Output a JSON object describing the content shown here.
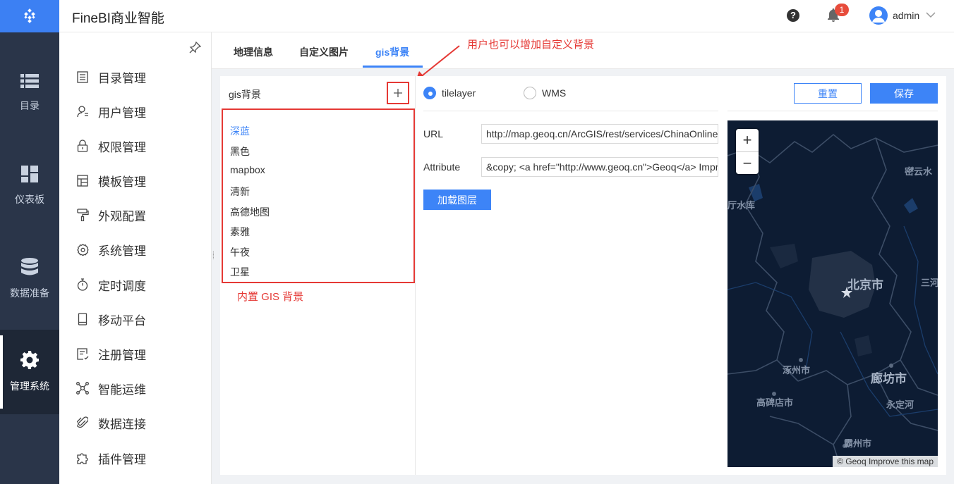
{
  "app": {
    "title": "FineBI商业智能"
  },
  "rail": {
    "items": [
      {
        "label": "目录",
        "icon": "list-icon"
      },
      {
        "label": "仪表板",
        "icon": "dashboard-icon"
      },
      {
        "label": "数据准备",
        "icon": "database-icon"
      },
      {
        "label": "管理系统",
        "icon": "gear-icon",
        "active": true
      }
    ]
  },
  "header": {
    "notification_count": "1",
    "user_name": "admin"
  },
  "nav": {
    "items": [
      {
        "label": "目录管理",
        "icon": "catalog-icon"
      },
      {
        "label": "用户管理",
        "icon": "user-icon"
      },
      {
        "label": "权限管理",
        "icon": "lock-icon"
      },
      {
        "label": "模板管理",
        "icon": "template-icon"
      },
      {
        "label": "外观配置",
        "icon": "paint-roller-icon"
      },
      {
        "label": "系统管理",
        "icon": "settings-icon"
      },
      {
        "label": "定时调度",
        "icon": "timer-icon"
      },
      {
        "label": "移动平台",
        "icon": "mobile-icon"
      },
      {
        "label": "注册管理",
        "icon": "register-icon"
      },
      {
        "label": "智能运维",
        "icon": "network-icon"
      },
      {
        "label": "数据连接",
        "icon": "paperclip-icon"
      },
      {
        "label": "插件管理",
        "icon": "puzzle-icon"
      }
    ]
  },
  "tabs": [
    {
      "label": "地理信息"
    },
    {
      "label": "自定义图片"
    },
    {
      "label": "gis背景",
      "active": true
    }
  ],
  "callouts": {
    "add_custom": "用户也可以增加自定义背景",
    "builtin": "内置 GIS 背景"
  },
  "gis_panel": {
    "title": "gis背景",
    "items": [
      "深蓝",
      "黑色",
      "mapbox",
      "清新",
      "高德地图",
      "素雅",
      "午夜",
      "卫星"
    ],
    "selected": "深蓝"
  },
  "form": {
    "radio_tilelayer": "tilelayer",
    "radio_wms": "WMS",
    "selected_type": "tilelayer",
    "url_label": "URL",
    "url_value": "http://map.geoq.cn/ArcGIS/rest/services/ChinaOnlineStreetPurplishBlue/MapServer/tile/{z}/{y}/{x}",
    "attribution_label": "Attribute",
    "attribution_value": "&copy; <a href=\"http://www.geoq.cn\">Geoq</a> Improve this map",
    "load_button": "加载图层",
    "reset_button": "重置",
    "save_button": "保存"
  },
  "map": {
    "zoom_in": "+",
    "zoom_out": "−",
    "labels": [
      "密云水",
      "厅水库",
      "北京市",
      "三河",
      "涿州市",
      "廊坊市",
      "高碑店市",
      "永定河",
      "霸州市"
    ],
    "attribution": "© Geoq Improve this map"
  },
  "colors": {
    "accent": "#3d84f7",
    "rail_bg": "#2a3549",
    "callout": "#e53935",
    "map_bg": "#0d1c33"
  }
}
